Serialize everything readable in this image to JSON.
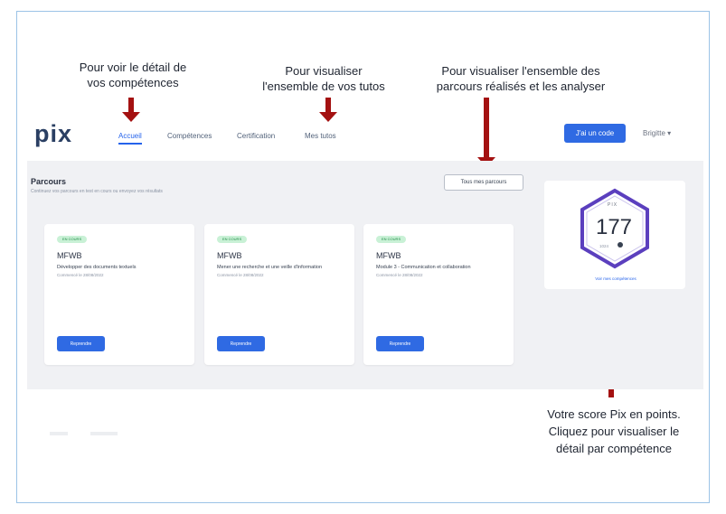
{
  "annotations": {
    "competences": "Pour voir le détail de\nvos compétences",
    "tutos": "Pour visualiser\nl'ensemble de vos tutos",
    "parcours": "Pour visualiser l'ensemble des\nparcours réalisés et les analyser",
    "score": "Votre score Pix en points.\nCliquez pour visualiser le\ndétail par compétence"
  },
  "header": {
    "logo": "pix",
    "nav": [
      "Accueil",
      "Compétences",
      "Certification",
      "Mes tutos"
    ],
    "active_index": 0,
    "code_button": "J'ai un code",
    "user_menu": "Brigitte ▾"
  },
  "parcours": {
    "title": "Parcours",
    "subtitle": "Continuez vos parcours en test en cours ou envoyez vos résultats",
    "all_button": "Tous mes parcours",
    "cards": [
      {
        "badge": "EN COURS",
        "code": "MFWB",
        "description": "Développer des documents textuels",
        "date": "Commencé le 28/08/2022",
        "button": "Reprendre"
      },
      {
        "badge": "EN COURS",
        "code": "MFWB",
        "description": "Mener une recherche et une veille d'information",
        "date": "Commencé le 28/08/2022",
        "button": "Reprendre"
      },
      {
        "badge": "EN COURS",
        "code": "MFWB",
        "description": "Module 3 - Communication et collaboration",
        "date": "Commencé le 28/08/2022",
        "button": "Reprendre"
      }
    ]
  },
  "score": {
    "label": "PIX",
    "value": "177",
    "max": "1024",
    "link": "Voir mes compétences"
  },
  "colors": {
    "accent": "#2f6ae3",
    "arrow": "#a41111",
    "hexagon": "#5b3fbe"
  }
}
